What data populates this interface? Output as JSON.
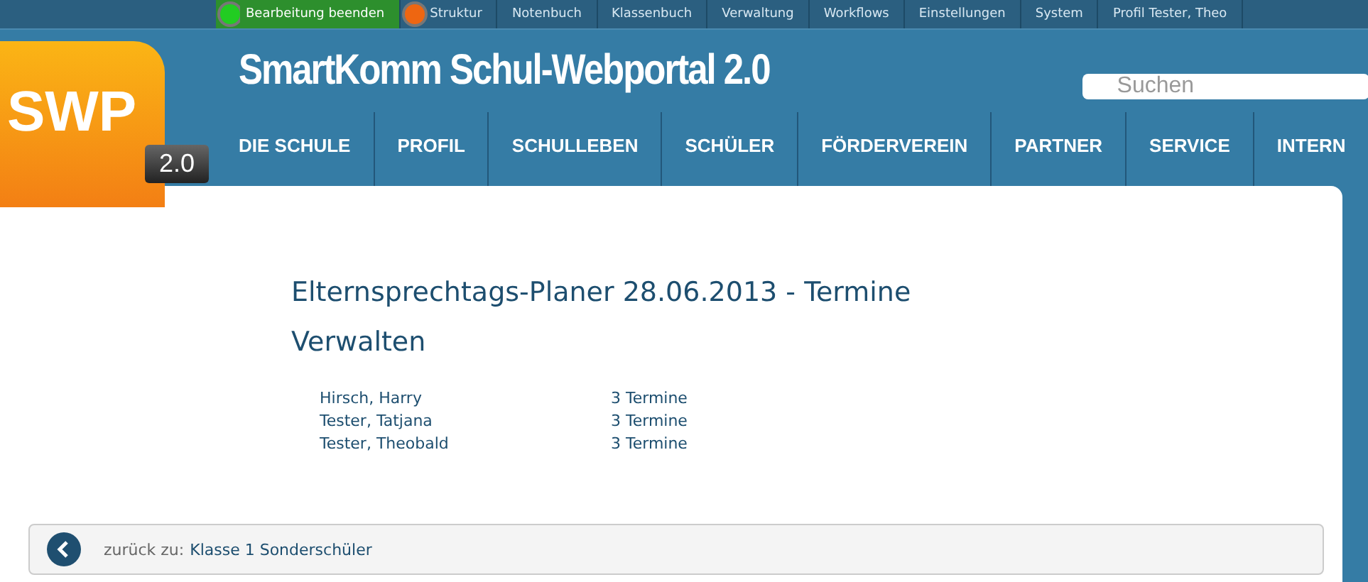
{
  "top_menu": [
    {
      "label": "Bearbeitung beenden",
      "kind": "status",
      "color": "#22cc22",
      "selected": true
    },
    {
      "label": "Struktur",
      "kind": "status",
      "color": "#ee6611",
      "selected": false
    },
    {
      "label": "Notenbuch",
      "kind": "plain",
      "selected": false
    },
    {
      "label": "Klassenbuch",
      "kind": "plain",
      "selected": false
    },
    {
      "label": "Verwaltung",
      "kind": "plain",
      "selected": false
    },
    {
      "label": "Workflows",
      "kind": "plain",
      "selected": false
    },
    {
      "label": "Einstellungen",
      "kind": "plain",
      "selected": false
    },
    {
      "label": "System",
      "kind": "plain",
      "selected": false
    },
    {
      "label": "Profil Tester, Theo",
      "kind": "plain",
      "selected": false
    }
  ],
  "logo": {
    "text": "SWP",
    "version": "2.0"
  },
  "site_title": "SmartKomm Schul-Webportal 2.0",
  "search": {
    "placeholder": "Suchen"
  },
  "main_nav": [
    "DIE SCHULE",
    "PROFIL",
    "SCHULLEBEN",
    "SCHÜLER",
    "FÖRDERVEREIN",
    "PARTNER",
    "SERVICE",
    "INTERN"
  ],
  "page_title": "Elternsprechtags-Planer 28.06.2013 - Termine Verwalten",
  "rows": [
    {
      "name": "Hirsch, Harry",
      "count": "3 Termine"
    },
    {
      "name": "Tester, Tatjana",
      "count": "3 Termine"
    },
    {
      "name": "Tester, Theobald",
      "count": "3 Termine"
    }
  ],
  "back": {
    "prefix": "zurück zu:",
    "link": "Klasse 1 Sonderschüler"
  }
}
